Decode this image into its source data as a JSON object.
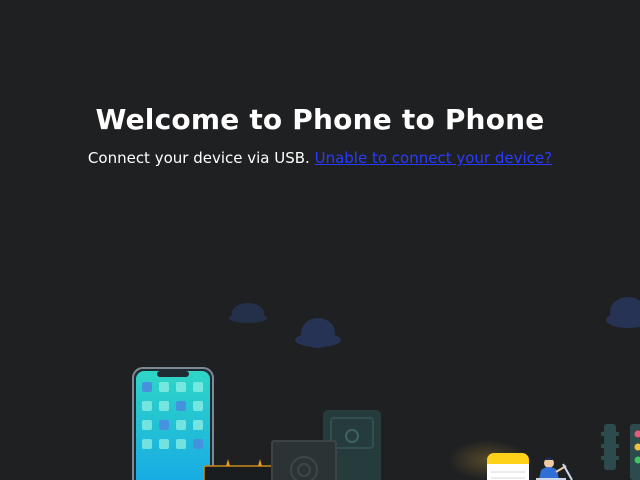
{
  "welcome": {
    "title": "Welcome to Phone to Phone",
    "instruction": "Connect your device via USB.",
    "help_link": "Unable to connect your device?"
  },
  "colors": {
    "background": "#1f2022",
    "link": "#2a3bff",
    "phone_screen_top": "#2fd6c6",
    "phone_screen_bottom": "#16a8e6",
    "cloud": "#2b3a5a",
    "sticky_note": "#ffd21a",
    "traffic_light": "#2d4a4c"
  },
  "icons": [
    "phone-illustration",
    "cloud-icon",
    "safe-illustration",
    "router-illustration",
    "notes-icon",
    "person-illustration",
    "traffic-light-illustration"
  ]
}
